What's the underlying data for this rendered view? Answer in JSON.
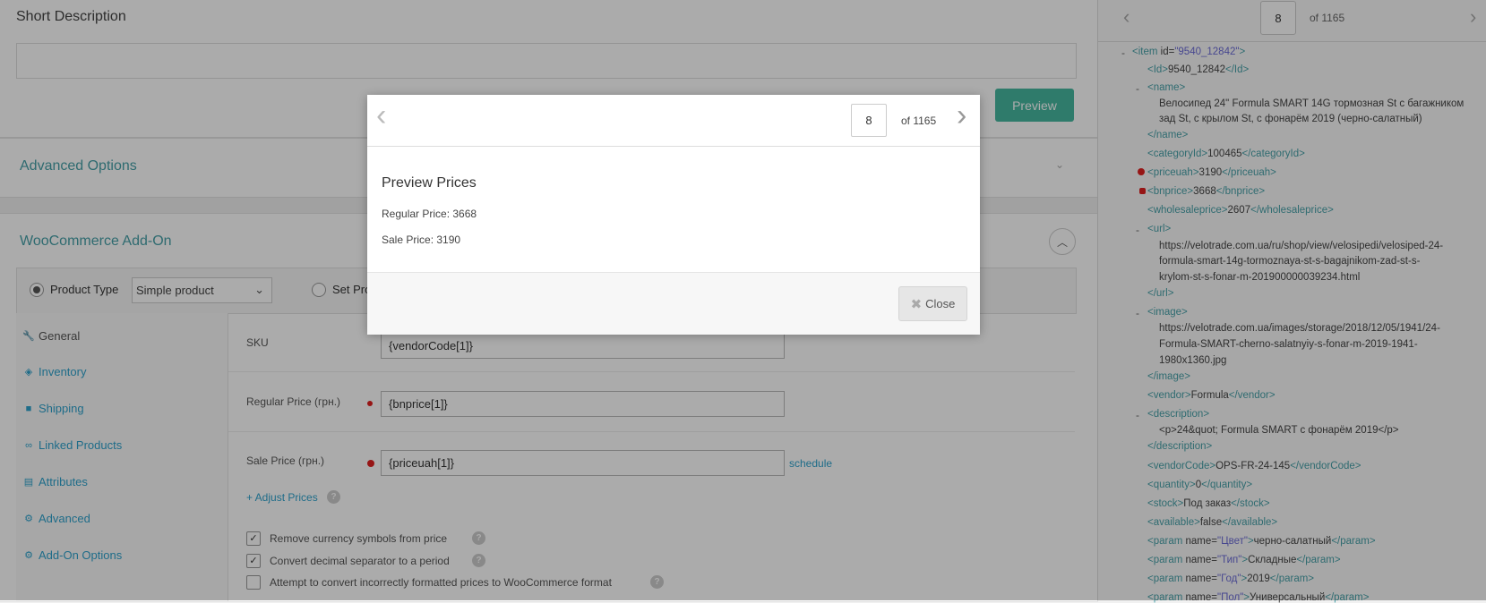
{
  "main": {
    "short_description": {
      "title": "Short Description",
      "preview_label": "Preview"
    },
    "advanced_options": {
      "title": "Advanced Options"
    },
    "woocommerce": {
      "title": "WooCommerce Add-On",
      "product_type_label": "Product Type",
      "product_type_value": "Simple product",
      "set_product_label": "Set Pro",
      "nav": [
        {
          "label": "General",
          "icon": "wrench-icon"
        },
        {
          "label": "Inventory",
          "icon": "tag-icon"
        },
        {
          "label": "Shipping",
          "icon": "truck-icon"
        },
        {
          "label": "Linked Products",
          "icon": "link-icon"
        },
        {
          "label": "Attributes",
          "icon": "list-icon"
        },
        {
          "label": "Advanced",
          "icon": "gear-icon"
        },
        {
          "label": "Add-On Options",
          "icon": "gear-icon"
        }
      ],
      "sku": {
        "label": "SKU",
        "value": "{vendorCode[1]}"
      },
      "regular_price": {
        "label": "Regular Price (грн.)",
        "value": "{bnprice[1]}"
      },
      "sale_price": {
        "label": "Sale Price (грн.)",
        "value": "{priceuah[1]}",
        "schedule": "schedule"
      },
      "adjust_prices": "+ Adjust Prices",
      "options": [
        {
          "label": "Remove currency symbols from price",
          "checked": true
        },
        {
          "label": "Convert decimal separator to a period",
          "checked": true
        },
        {
          "label": "Attempt to convert incorrectly formatted prices to WooCommerce format",
          "checked": false
        }
      ]
    }
  },
  "xml_panel": {
    "page": "8",
    "of": "of 1165",
    "lines": {
      "item_open_tag": "<item",
      "item_attr": "id=",
      "item_attr_val": "\"9540_12842\"",
      "item_close": ">",
      "id": "9540_12842",
      "name_text_1": "Велосипед 24\" Formula SMART 14G тормозная St с багажником",
      "name_text_2": "зад St, с крылом St, с фонарём 2019 (черно-салатный)",
      "categoryId": "100465",
      "priceuah": "3190",
      "bnprice": "3668",
      "wholesaleprice": "2607",
      "url_1": "https://velotrade.com.ua/ru/shop/view/velosipedi/velosiped-24-",
      "url_2": "formula-smart-14g-tormoznaya-st-s-bagajnikom-zad-st-s-",
      "url_3": "krylom-st-s-fonar-m-201900000039234.html",
      "image_1": "https://velotrade.com.ua/images/storage/2018/12/05/1941/24-",
      "image_2": "Formula-SMART-cherno-salatnyiy-s-fonar-m-2019-1941-",
      "image_3": "1980x1360.jpg",
      "vendor": "Formula",
      "description_text": "<p>24&quot; Formula SMART с фонарём 2019</p>",
      "vendorCode": "OPS-FR-24-145",
      "quantity": "0",
      "stock": "Под заказ",
      "available": "false",
      "param1_name": "\"Цвет\"",
      "param1_val": "черно-салатный",
      "param2_name": "\"Тип\"",
      "param2_val": "Складные",
      "param3_name": "\"Год\"",
      "param3_val": "2019",
      "param4_name": "\"Пол\"",
      "param4_val": "Универсальный"
    }
  },
  "modal": {
    "page": "8",
    "of": "of 1165",
    "title": "Preview Prices",
    "regular": "Regular Price: 3668",
    "sale": "Sale Price: 3190",
    "close": "Close"
  }
}
